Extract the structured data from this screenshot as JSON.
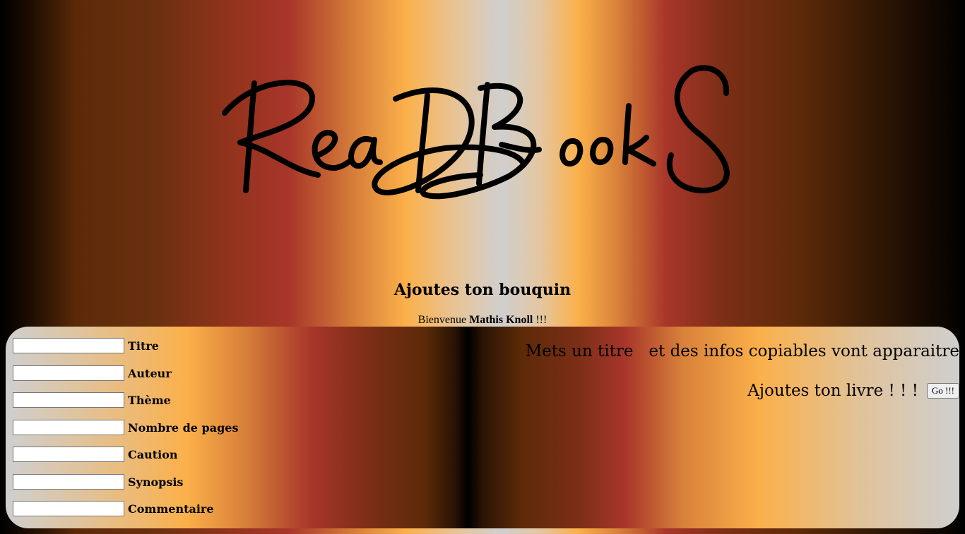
{
  "header": {
    "logo_text": "ReaDBookS",
    "page_title": "Ajoutes ton bouquin"
  },
  "welcome": {
    "prefix": "Bienvenue ",
    "user_name": "Mathis Knoll",
    "suffix": " !!!"
  },
  "form": {
    "fields": [
      {
        "label": "Titre",
        "value": ""
      },
      {
        "label": "Auteur",
        "value": ""
      },
      {
        "label": "Thème",
        "value": ""
      },
      {
        "label": "Nombre de pages",
        "value": ""
      },
      {
        "label": "Caution",
        "value": ""
      },
      {
        "label": "Synopsis",
        "value": ""
      },
      {
        "label": "Commentaire",
        "value": ""
      }
    ],
    "hint_text": "Mets un titre   et des infos copiables vont apparaitre",
    "add_label": "Ajoutes ton livre ! ! !",
    "go_button_label": "Go !!!"
  }
}
